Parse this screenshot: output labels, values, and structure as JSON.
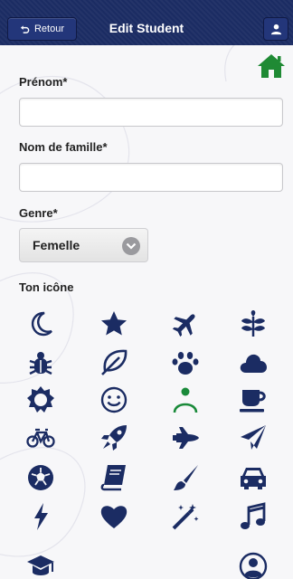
{
  "header": {
    "back_label": "Retour",
    "title": "Edit Student"
  },
  "form": {
    "first_name_label": "Prénom*",
    "first_name_value": "",
    "last_name_label": "Nom de famille*",
    "last_name_value": "",
    "gender_label": "Genre*",
    "gender_value": "Femelle",
    "icon_section_label": "Ton icône"
  },
  "icons": [
    "moon-icon",
    "star-icon",
    "plane-icon",
    "leaf-branch-icon",
    "bug-icon",
    "leaf-icon",
    "paw-icon",
    "cloud-icon",
    "sun-icon",
    "smile-icon",
    "person-icon",
    "coffee-icon",
    "bicycle-icon",
    "rocket-icon",
    "space-shuttle-icon",
    "paper-plane-icon",
    "soccer-ball-icon",
    "book-icon",
    "paint-brush-icon",
    "car-icon",
    "lightning-icon",
    "heart-icon",
    "magic-wand-icon",
    "music-icon",
    "graduation-cap-icon",
    "user-circle-icon"
  ],
  "colors": {
    "header": "#1b2c63",
    "icon": "#1b2c63",
    "selected_icon": "#1a8a3a",
    "home": "#1f8a34"
  }
}
